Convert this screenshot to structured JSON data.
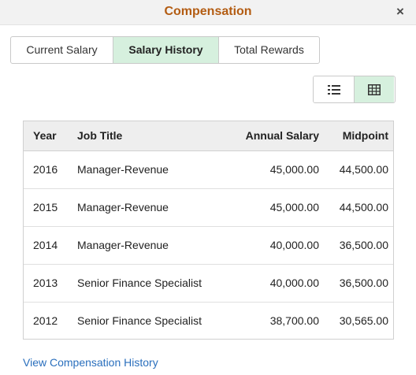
{
  "header": {
    "title": "Compensation",
    "close_label": "×"
  },
  "tabs": [
    {
      "label": "Current Salary",
      "active": false
    },
    {
      "label": "Salary History",
      "active": true
    },
    {
      "label": "Total Rewards",
      "active": false
    }
  ],
  "view_toggle": {
    "options": [
      "list-icon",
      "grid-icon"
    ],
    "selected": "grid-icon"
  },
  "table": {
    "columns": [
      "Year",
      "Job Title",
      "Annual Salary",
      "Midpoint"
    ],
    "rows": [
      {
        "year": "2016",
        "job": "Manager-Revenue",
        "salary": "45,000.00",
        "midpoint": "44,500.00"
      },
      {
        "year": "2015",
        "job": "Manager-Revenue",
        "salary": "45,000.00",
        "midpoint": "44,500.00"
      },
      {
        "year": "2014",
        "job": "Manager-Revenue",
        "salary": "40,000.00",
        "midpoint": "36,500.00"
      },
      {
        "year": "2013",
        "job": "Senior Finance Specialist",
        "salary": "40,000.00",
        "midpoint": "36,500.00"
      },
      {
        "year": "2012",
        "job": "Senior Finance Specialist",
        "salary": "38,700.00",
        "midpoint": "30,565.00"
      }
    ]
  },
  "footer": {
    "link_label": "View Compensation History"
  },
  "colors": {
    "title": "#b35c12",
    "active_tab": "#d6f0de",
    "link": "#2a6fbd"
  }
}
